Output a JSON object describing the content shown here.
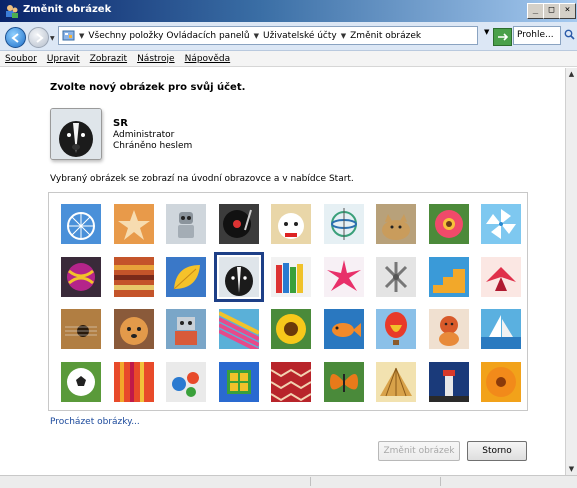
{
  "window": {
    "title": "Změnit obrázek",
    "minimize": "_",
    "maximize": "□",
    "close": "×"
  },
  "address": {
    "crumbs": [
      "Všechny položky Ovládacích panelů",
      "Uživatelské účty",
      "Změnit obrázek"
    ],
    "search_placeholder": "Prohle..."
  },
  "menu": {
    "items": [
      "Soubor",
      "Upravit",
      "Zobrazit",
      "Nástroje",
      "Nápověda"
    ]
  },
  "page": {
    "heading": "Zvolte nový obrázek pro svůj účet.",
    "user_name": "SR",
    "user_role": "Administrator",
    "user_password_status": "Chráněno heslem",
    "info_text": "Vybraný obrázek se zobrazí na úvodní obrazovce a v nabídce Start.",
    "browse_link": "Procházet obrázky...",
    "change_button": "Změnit obrázek",
    "cancel_button": "Storno"
  },
  "pictures": [
    "ferris-wheel",
    "starfish",
    "robot-toy",
    "turntable",
    "lucky-cat",
    "gyroscope",
    "kitten",
    "gerbera",
    "pinwheel",
    "ball",
    "fabric",
    "leaf",
    "dog",
    "crayons",
    "star-flower",
    "jacks",
    "stairs",
    "paper-crane",
    "guitar",
    "puppy",
    "robot",
    "hammock",
    "sunflower",
    "fish",
    "hot-air-balloon",
    "wooden-toy",
    "sailboat",
    "soccer-ball",
    "scarf",
    "marbles",
    "window",
    "knitting",
    "butterfly",
    "shell",
    "lighthouse",
    "orange-flower"
  ],
  "selected_picture": "dog",
  "colors": {
    "titlebar": "#0a246a",
    "selection": "#1d3f87",
    "link": "#1c4a9c"
  }
}
